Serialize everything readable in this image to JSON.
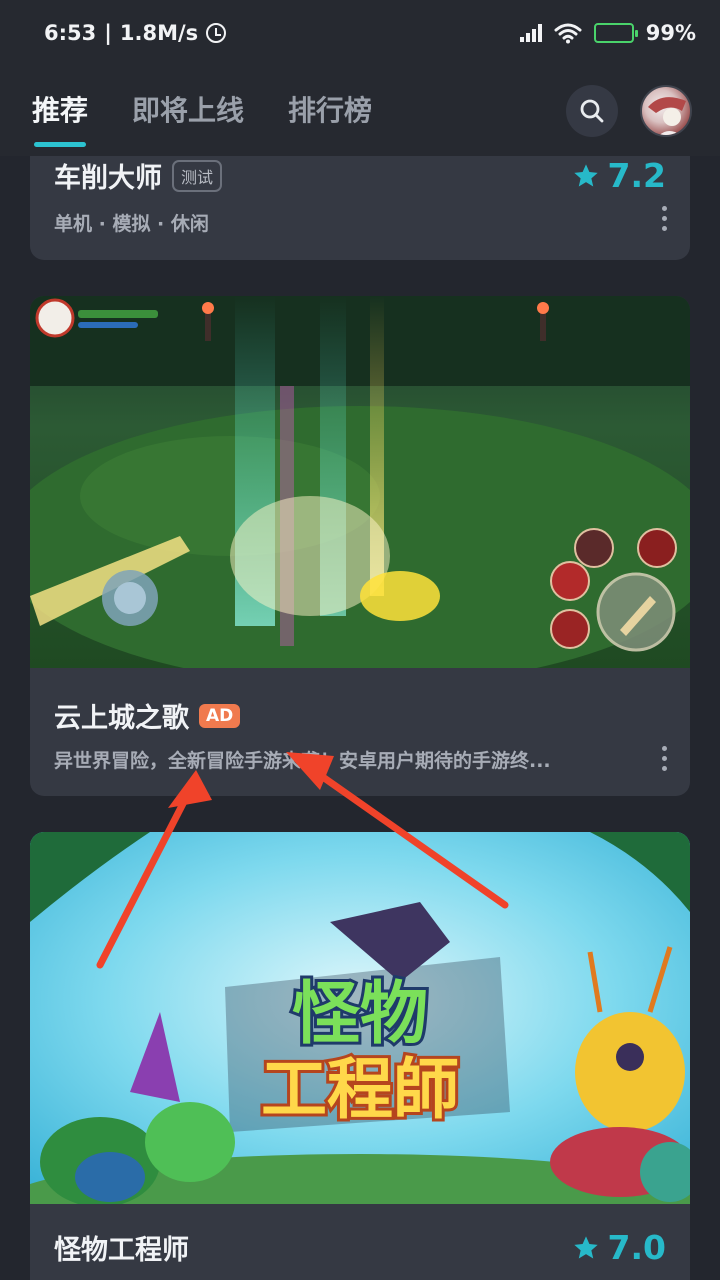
{
  "status_bar": {
    "time": "6:53",
    "speed": "1.8M/s",
    "battery": "99%"
  },
  "header": {
    "tabs": [
      {
        "label": "推荐",
        "active": true
      },
      {
        "label": "即将上线",
        "active": false
      },
      {
        "label": "排行榜",
        "active": false
      }
    ],
    "search_icon": "search-icon",
    "avatar_icon": "user-avatar"
  },
  "feed": {
    "cards": [
      {
        "title": "车削大师",
        "badge": "测试",
        "rating": "7.2",
        "subtitle": "单机 · 模拟 · 休闲"
      },
      {
        "title": "云上城之歌",
        "badge": "AD",
        "subtitle": "异世界冒险，全新冒险手游来袭！安卓用户期待的手游终..."
      },
      {
        "title": "怪物工程师",
        "rating": "7.0",
        "banner_text_line1": "怪物",
        "banner_text_line2": "工程師"
      }
    ]
  },
  "colors": {
    "accent": "#2cc3d1",
    "ad_badge": "#f07a4e",
    "annotation_arrow": "#f0432a"
  }
}
